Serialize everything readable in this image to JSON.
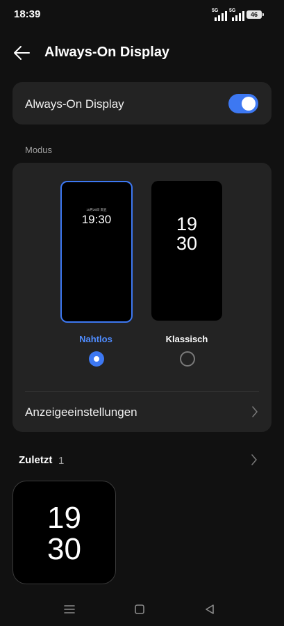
{
  "status_bar": {
    "time": "18:39",
    "signal1_label": "5G",
    "signal2_label": "5G",
    "battery": "46"
  },
  "header": {
    "title": "Always-On Display"
  },
  "aod_setting": {
    "label": "Always-On Display",
    "enabled": true
  },
  "modus": {
    "section_label": "Modus",
    "options": [
      {
        "label": "Nahtlos",
        "selected": true,
        "preview_date": "10月26日 周五",
        "preview_time": "19:30"
      },
      {
        "label": "Klassisch",
        "selected": false,
        "preview_hour": "19",
        "preview_minute": "30"
      }
    ],
    "display_settings_label": "Anzeigeeinstellungen"
  },
  "recent": {
    "title": "Zuletzt",
    "count": "1",
    "items": [
      {
        "hour": "19",
        "minute": "30"
      }
    ]
  },
  "colors": {
    "accent": "#3d78f2",
    "card": "#232323",
    "background": "#111111"
  }
}
